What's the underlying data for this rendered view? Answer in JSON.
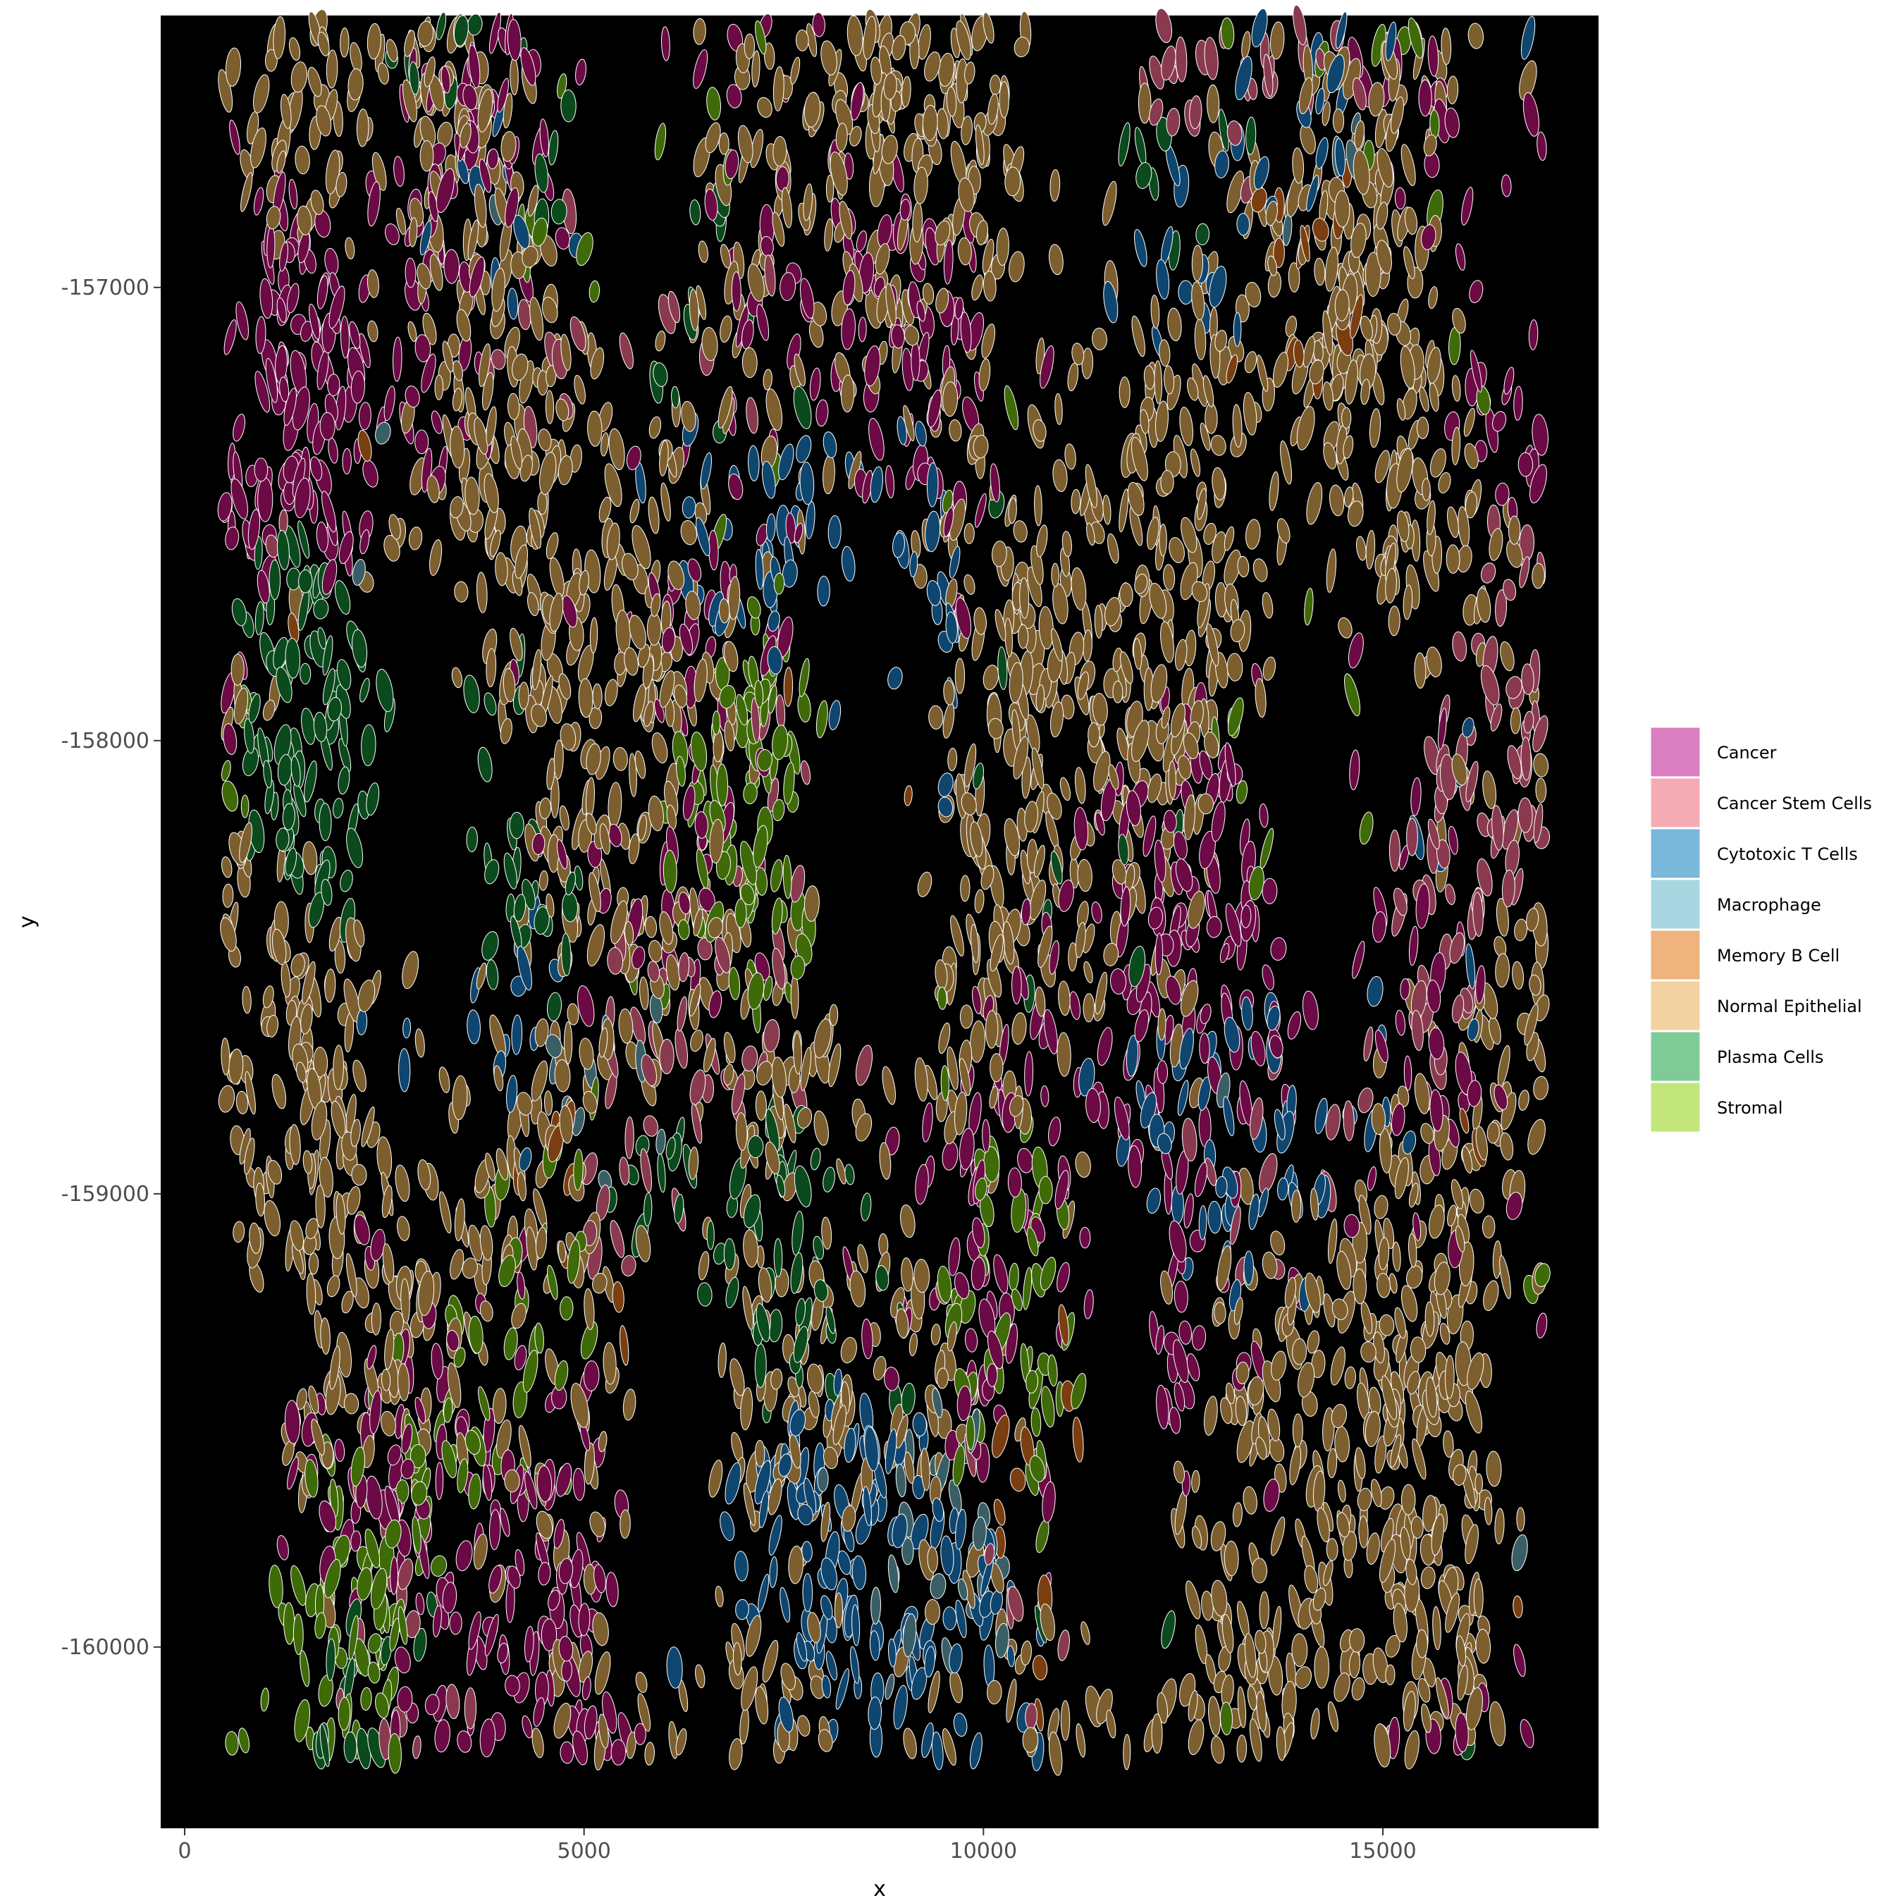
{
  "chart_data": {
    "type": "scatter",
    "title": "",
    "xlabel": "x",
    "ylabel": "y",
    "xlim": [
      -300,
      17700
    ],
    "ylim": [
      -160400,
      -156400
    ],
    "data_extent": {
      "x": [
        500,
        17000
      ],
      "y": [
        -160240,
        -156420
      ]
    },
    "background": "#000000",
    "grid": false,
    "x_ticks": [
      {
        "value": 0,
        "label": "0"
      },
      {
        "value": 5000,
        "label": "5000"
      },
      {
        "value": 10000,
        "label": "10000"
      },
      {
        "value": 15000,
        "label": "15000"
      }
    ],
    "y_ticks": [
      {
        "value": -157000,
        "label": "-157000"
      },
      {
        "value": -158000,
        "label": "-158000"
      },
      {
        "value": -159000,
        "label": "-159000"
      },
      {
        "value": -160000,
        "label": "-160000"
      }
    ],
    "legend_position": "right",
    "series": [
      {
        "name": "Cancer",
        "color": "#d97fbf",
        "fill": "#6b0a44"
      },
      {
        "name": "Cancer Stem Cells",
        "color": "#f5abb6",
        "fill": "#8a3a4e"
      },
      {
        "name": "Cytotoxic T Cells",
        "color": "#7ab8dc",
        "fill": "#0f4670"
      },
      {
        "name": "Macrophage",
        "color": "#a8d7e2",
        "fill": "#3a5e66"
      },
      {
        "name": "Memory B Cell",
        "color": "#efb37d",
        "fill": "#7a3e10"
      },
      {
        "name": "Normal Epithelial",
        "color": "#f2d3a1",
        "fill": "#7d5e2e"
      },
      {
        "name": "Plasma Cells",
        "color": "#7ecb97",
        "fill": "#0b4a1c"
      },
      {
        "name": "Stromal",
        "color": "#c2e67b",
        "fill": "#3f6a08"
      }
    ],
    "cell_outline": "#ffffff"
  }
}
